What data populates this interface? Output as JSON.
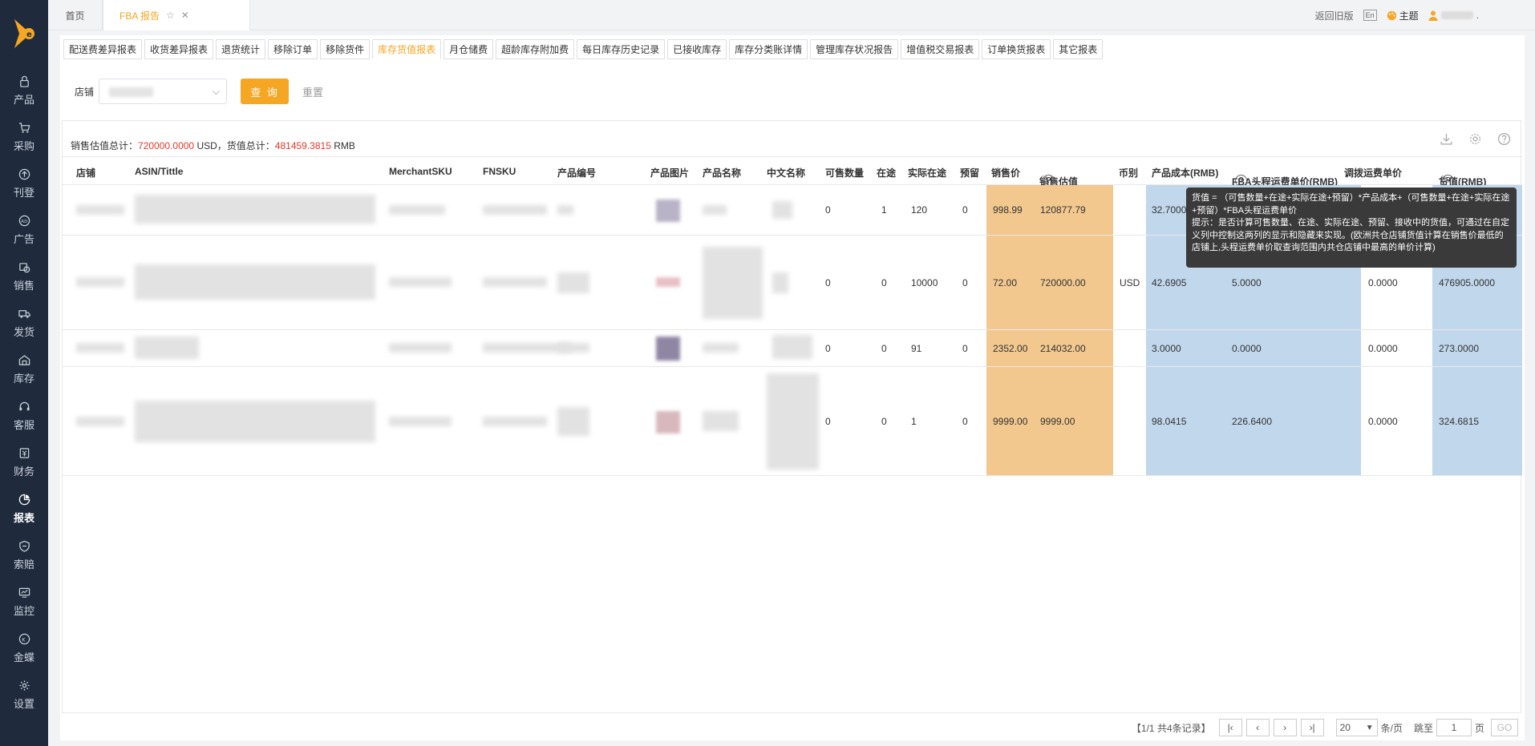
{
  "brand": {
    "accent": "#f5a623",
    "sidebar_bg": "#1f2b3d",
    "highlight_orange": "#f2c88f",
    "highlight_blue": "#c1d7ec",
    "red": "#e8372c"
  },
  "sidebar": {
    "items": [
      {
        "label": "产品",
        "icon": "lock-icon"
      },
      {
        "label": "采购",
        "icon": "cart-icon"
      },
      {
        "label": "刊登",
        "icon": "upload-icon"
      },
      {
        "label": "广告",
        "icon": "ad-icon"
      },
      {
        "label": "销售",
        "icon": "sales-icon"
      },
      {
        "label": "发货",
        "icon": "truck-icon"
      },
      {
        "label": "库存",
        "icon": "warehouse-icon"
      },
      {
        "label": "客服",
        "icon": "headset-icon"
      },
      {
        "label": "财务",
        "icon": "finance-icon"
      },
      {
        "label": "报表",
        "icon": "pie-chart-icon",
        "active": true
      },
      {
        "label": "索赔",
        "icon": "shield-icon"
      },
      {
        "label": "监控",
        "icon": "monitor-icon"
      },
      {
        "label": "金蝶",
        "icon": "kingdee-icon"
      },
      {
        "label": "设置",
        "icon": "gear-icon"
      }
    ]
  },
  "topbar": {
    "home_tab": "首页",
    "active_tab": "FBA 报告",
    "back_old": "返回旧版",
    "lang": "En",
    "theme": "主题",
    "user_suffix": "."
  },
  "subtabs": [
    "配送费差异报表",
    "收货差异报表",
    "退货统计",
    "移除订单",
    "移除货件",
    "库存货值报表",
    "月仓储费",
    "超龄库存附加费",
    "每日库存历史记录",
    "已接收库存",
    "库存分类账详情",
    "管理库存状况报告",
    "增值税交易报表",
    "订单换货报表",
    "其它报表"
  ],
  "active_subtab": "库存货值报表",
  "filter": {
    "shop_label": "店铺",
    "query_btn": "查 询",
    "reset_btn": "重置"
  },
  "summary": {
    "sales_label": "销售估值总计：",
    "sales_value": "720000.0000",
    "sales_unit": "USD，",
    "value_label": "货值总计：",
    "value_total": "481459.3815",
    "value_unit": "RMB"
  },
  "columns": {
    "shop": "店铺",
    "asin": "ASIN/Tittle",
    "msku": "MerchantSKU",
    "fnsku": "FNSKU",
    "product_no": "产品编号",
    "product_img": "产品图片",
    "product_name": "产品名称",
    "cn_name": "中文名称",
    "sellable": "可售数量",
    "in_transit": "在途",
    "actual_transit": "实际在途",
    "reserved": "预留",
    "price": "销售价",
    "sales_value": "销售估值",
    "currency": "币别",
    "cost": "产品成本(RMB)",
    "fba_freight": "FBA头程运费单价(RMB)",
    "transfer_freight": "调拨运费单价",
    "goods_value": "货值(RMB)"
  },
  "rows": [
    {
      "sellable": "0",
      "in_transit": "1",
      "actual_transit": "120",
      "reserved": "0",
      "price": "998.99",
      "sales_value": "120877.79",
      "currency": "",
      "cost": "32.7000",
      "fba": "",
      "transfer": "",
      "goods": ""
    },
    {
      "sellable": "0",
      "in_transit": "0",
      "actual_transit": "10000",
      "reserved": "0",
      "price": "72.00",
      "sales_value": "720000.00",
      "currency": "USD",
      "cost": "42.6905",
      "fba": "5.0000",
      "transfer": "0.0000",
      "goods": "476905.0000"
    },
    {
      "sellable": "0",
      "in_transit": "0",
      "actual_transit": "91",
      "reserved": "0",
      "price": "2352.00",
      "sales_value": "214032.00",
      "currency": "",
      "cost": "3.0000",
      "fba": "0.0000",
      "transfer": "0.0000",
      "goods": "273.0000"
    },
    {
      "sellable": "0",
      "in_transit": "0",
      "actual_transit": "1",
      "reserved": "0",
      "price": "9999.00",
      "sales_value": "9999.00",
      "currency": "",
      "cost": "98.0415",
      "fba": "226.6400",
      "transfer": "0.0000",
      "goods": "324.6815"
    }
  ],
  "tooltip": {
    "line1": "货值 = （可售数量+在途+实际在途+预留）*产品成本+（可售数量+在途+实际在途+预留）*FBA头程运费单价",
    "line2": "提示：是否计算可售数量、在途、实际在途、预留、接收中的货值，可通过在自定义列中控制这两列的显示和隐藏来实现。(欧洲共仓店铺货值计算在销售价最低的店铺上,头程运费单价取查询范围内共仓店铺中最高的单价计算)"
  },
  "pager": {
    "info": "【1/1   共4条记录】",
    "page_size": "20",
    "per_page": "条/页",
    "jump_label": "跳至",
    "jump_value": "1",
    "page_unit": "页",
    "go": "GO"
  }
}
